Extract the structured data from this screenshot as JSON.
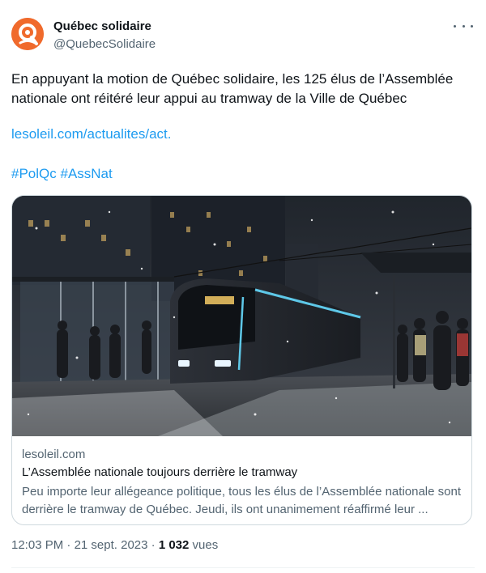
{
  "author": {
    "name": "Québec solidaire",
    "handle": "@QuebecSolidaire",
    "avatar_icon": "qs-logo-icon",
    "avatar_color": "#f06a2c"
  },
  "more_icon": "more-dots-icon",
  "tweet": {
    "text": "En appuyant la motion de Québec solidaire, les 125 élus de l’Assemblée nationale ont réitéré leur appui au tramway de la Ville de Québec",
    "link": "lesoleil.com/actualites/act.",
    "hashtags": [
      "#PolQc",
      "#AssNat"
    ]
  },
  "card": {
    "image_sign": "Pôle La Sambre",
    "domain": "lesoleil.com",
    "title": "L’Assemblée nationale toujours derrière le tramway",
    "description": "Peu importe leur allégeance politique, tous les élus de l’Assemblée nationale sont derrière le tramway de Québec. Jeudi, ils ont unanimement réaffirmé leur ..."
  },
  "meta": {
    "time": "12:03 PM",
    "separator": "·",
    "date": "21 sept. 2023",
    "views_count": "1 032",
    "views_label": "vues"
  },
  "colors": {
    "link": "#1d9bf0",
    "secondary_text": "#536471",
    "border": "#cfd9de"
  }
}
